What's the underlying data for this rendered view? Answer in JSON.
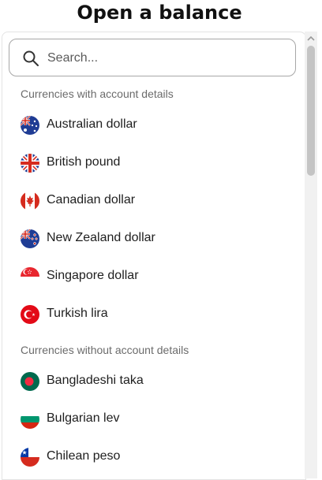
{
  "title": "Open a balance",
  "search": {
    "placeholder": "Search...",
    "icon": "search-icon"
  },
  "sections": [
    {
      "header": "Currencies with account details",
      "items": [
        {
          "label": "Australian dollar",
          "flag": "australia-flag-icon"
        },
        {
          "label": "British pound",
          "flag": "uk-flag-icon"
        },
        {
          "label": "Canadian dollar",
          "flag": "canada-flag-icon"
        },
        {
          "label": "New Zealand dollar",
          "flag": "new-zealand-flag-icon"
        },
        {
          "label": "Singapore dollar",
          "flag": "singapore-flag-icon"
        },
        {
          "label": "Turkish lira",
          "flag": "turkey-flag-icon"
        }
      ]
    },
    {
      "header": "Currencies without account details",
      "items": [
        {
          "label": "Bangladeshi taka",
          "flag": "bangladesh-flag-icon"
        },
        {
          "label": "Bulgarian lev",
          "flag": "bulgaria-flag-icon"
        },
        {
          "label": "Chilean peso",
          "flag": "chile-flag-icon"
        }
      ]
    }
  ],
  "colors": {
    "text": "#1e1e1e",
    "section_header": "#6b6b6b",
    "search_border": "#a7a7a7",
    "scrollbar_thumb": "#c4c4c4"
  }
}
